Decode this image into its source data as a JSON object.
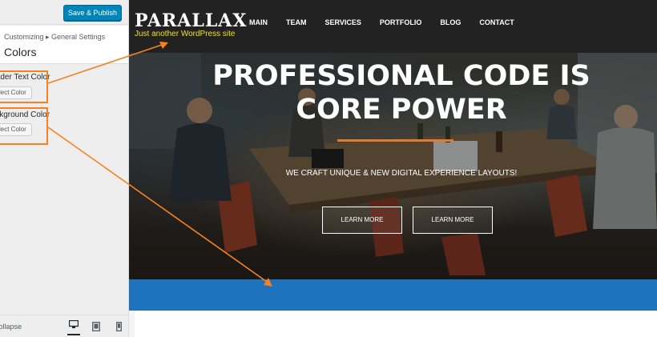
{
  "sidebar": {
    "publish_label": "Save & Publish",
    "breadcrumb": "Customizing ▸ General Settings",
    "section_title": "Colors",
    "controls": [
      {
        "label": "Header Text Color",
        "button": "Select Color"
      },
      {
        "label": "Background Color",
        "button": "Select Color"
      }
    ],
    "collapse_label": "Collapse",
    "devices": [
      "desktop-icon",
      "tablet-icon",
      "mobile-icon"
    ]
  },
  "site": {
    "title": "PARALLAX",
    "tagline": "Just another WordPress site",
    "nav": [
      "MAIN",
      "TEAM",
      "SERVICES",
      "PORTFOLIO",
      "BLOG",
      "CONTACT"
    ],
    "hero_title": "PROFESSIONAL CODE IS CORE POWER",
    "hero_subtitle": "WE CRAFT UNIQUE & NEW DIGITAL EXPERIENCE LAYOUTS!",
    "buttons": [
      "LEARN MORE",
      "LEARN MORE"
    ]
  },
  "colors": {
    "publish": "#0085ba",
    "tagline": "#f1e11b",
    "accent": "#e07b30",
    "band": "#1e73be",
    "annotation": "#f58220"
  }
}
